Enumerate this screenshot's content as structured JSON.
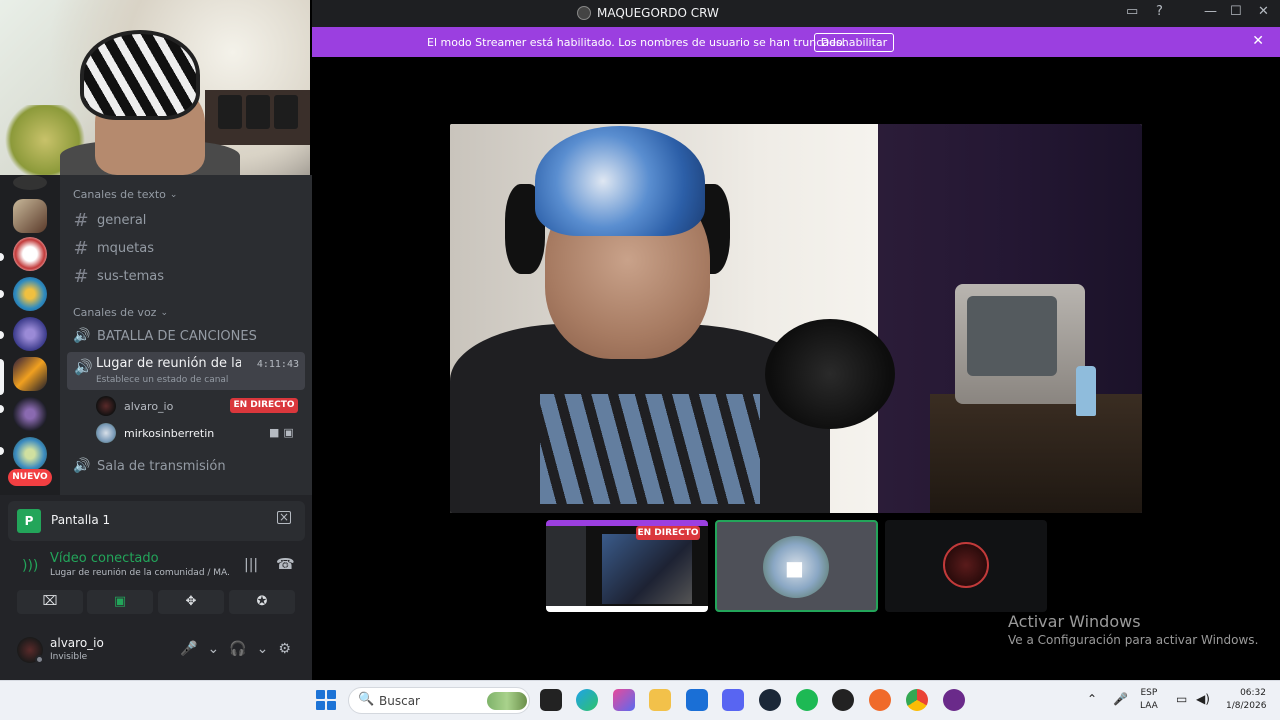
{
  "window": {
    "title": "MAQUEGORDO CRW",
    "minimize": "—",
    "maximize": "☐",
    "close": "✕"
  },
  "banner": {
    "message": "El modo Streamer está habilitado. Los nombres de usuario se han truncado.",
    "button": "Deshabilitar",
    "close": "✕"
  },
  "sidebar": {
    "text_category": "Canales de texto",
    "voice_category": "Canales de voz",
    "text_channels": [
      "general",
      "mquetas",
      "sus-temas"
    ],
    "voice_channels": {
      "battle": "BATALLA DE CANCIONES",
      "active": "Lugar de reunión de la ...",
      "active_status": "Establece un estado de canal",
      "active_timer": "4:11:43",
      "stream_room": "Sala de transmisión"
    },
    "voice_users": [
      {
        "name": "alvaro_io",
        "badge": "EN DIRECTO"
      },
      {
        "name": "mirkosinberretin"
      }
    ],
    "new_badge": "NUEVO"
  },
  "panel": {
    "screen_label": "Pantalla 1",
    "screen_icon": "P",
    "video_status": "Vídeo conectado",
    "video_location": "Lugar de reunión de la comunidad / MA..."
  },
  "user": {
    "name": "alvaro_io",
    "status": "Invisible"
  },
  "stage": {
    "thumb_live": "EN DIRECTO"
  },
  "activation": {
    "title": "Activar Windows",
    "subtitle": "Ve a Configuración para activar Windows."
  },
  "taskbar": {
    "search": "Buscar",
    "lang_top": "ESP",
    "lang_bottom": "LAA",
    "time": "06:32",
    "date": "1/8/2026"
  },
  "icons": {
    "hash": "#",
    "speaker": "🔊",
    "plus": "+",
    "chevron": "⌄",
    "search": "🔍",
    "gear": "⚙",
    "mic": "🎤",
    "headphones": "🎧"
  },
  "colors": {
    "accent_green": "#23a55a",
    "banner": "#9b3fe0",
    "live_red": "#da373c"
  }
}
